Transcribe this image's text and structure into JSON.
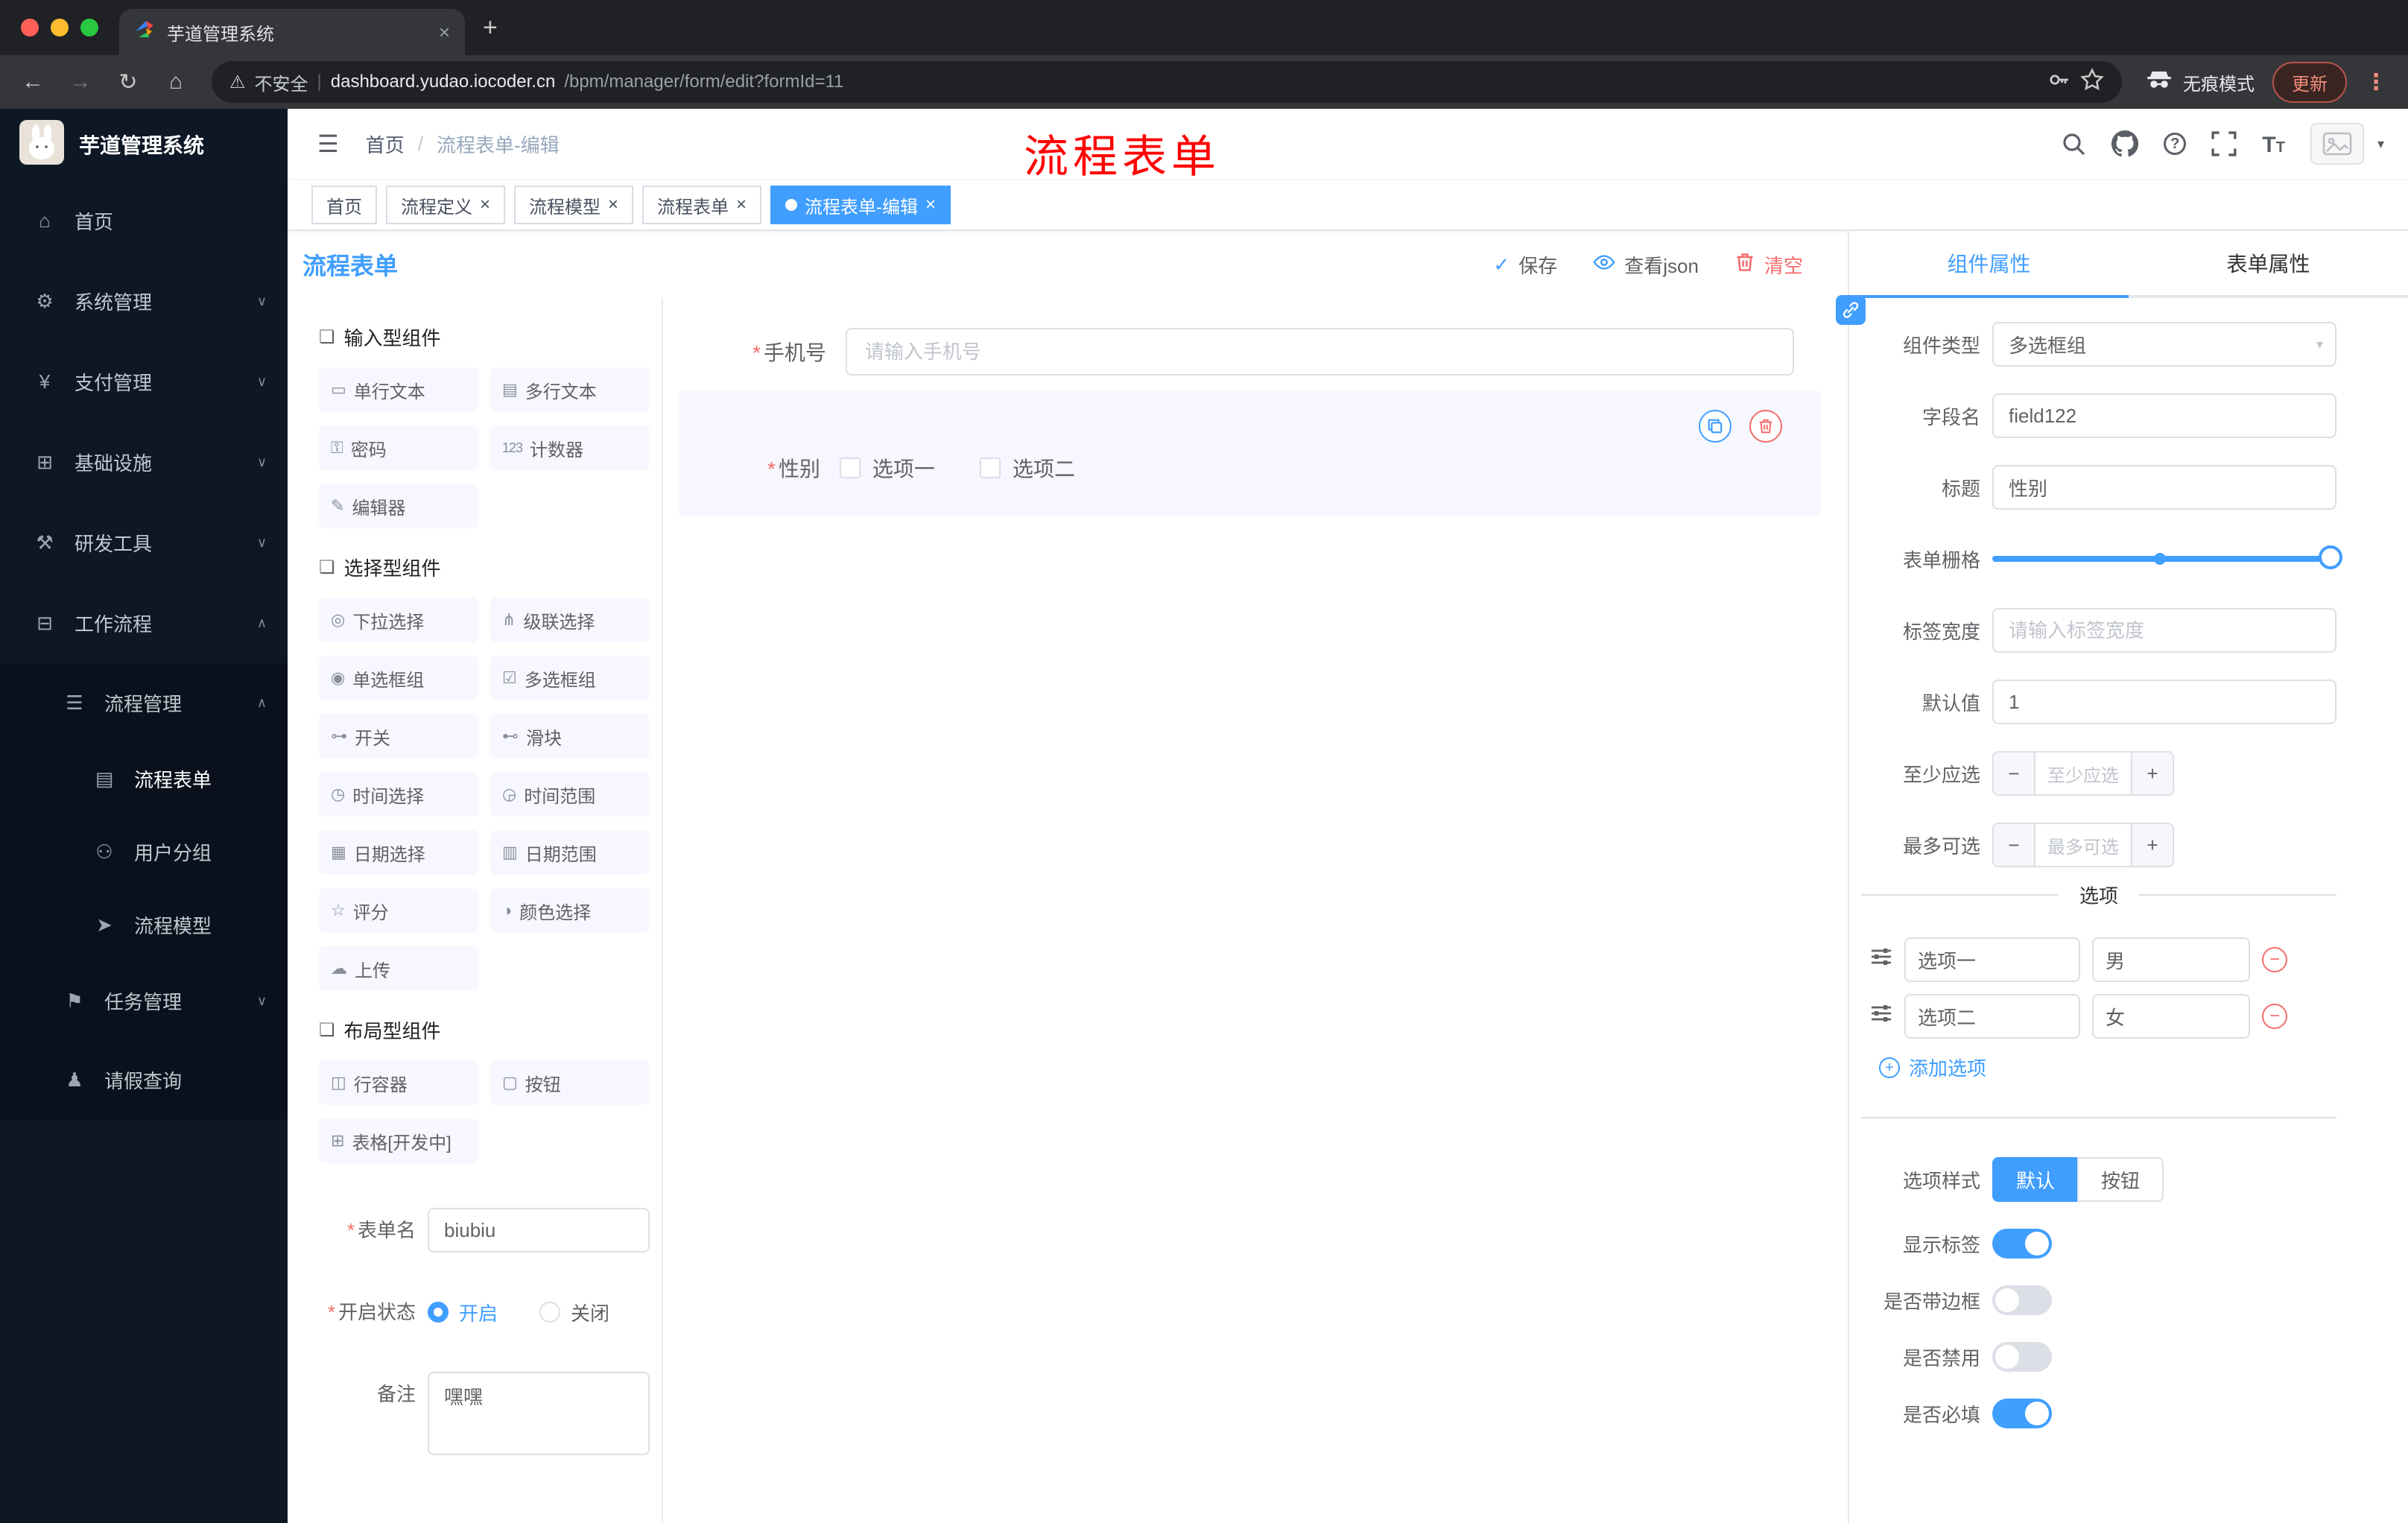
{
  "ui": {
    "close": "×",
    "plus": "+",
    "minus": "−",
    "dots": "⋮",
    "breadcrumb_sep": "/",
    "required": "*",
    "caret_down": "∨",
    "caret_up": "∧",
    "select_caret": "▾",
    "hamburger": "☰",
    "check": "✓",
    "section_icon": "❏",
    "question": "?",
    "size_big": "T",
    "size_small": "T",
    "back": "←",
    "forward": "→",
    "reload": "↻",
    "home": "⌂",
    "warning": "⚠"
  },
  "browser": {
    "tab_title": "芋道管理系统",
    "security_label": "不安全",
    "url_domain": "dashboard.yudao.iocoder.cn",
    "url_path": "/bpm/manager/form/edit?formId=11",
    "incognito_label": "无痕模式",
    "update_label": "更新"
  },
  "sidebar": {
    "logo_title": "芋道管理系统",
    "menu": [
      {
        "label": "首页",
        "icon": "⌂"
      },
      {
        "label": "系统管理",
        "icon": "⚙"
      },
      {
        "label": "支付管理",
        "icon": "¥"
      },
      {
        "label": "基础设施",
        "icon": "⊞"
      },
      {
        "label": "研发工具",
        "icon": "⚒"
      },
      {
        "label": "工作流程",
        "icon": "⊟"
      }
    ],
    "process_mgmt": {
      "label": "流程管理",
      "icon": "☰"
    },
    "children": [
      {
        "label": "流程表单",
        "icon": "▤"
      },
      {
        "label": "用户分组",
        "icon": "⚇"
      },
      {
        "label": "流程模型",
        "icon": "➤"
      }
    ],
    "siblings": [
      {
        "label": "任务管理",
        "icon": "⚑"
      },
      {
        "label": "请假查询",
        "icon": "♟"
      }
    ]
  },
  "header": {
    "breadcrumb_home": "首页",
    "breadcrumb_current": "流程表单-编辑",
    "annotation": "流程表单"
  },
  "tags": [
    {
      "label": "首页"
    },
    {
      "label": "流程定义"
    },
    {
      "label": "流程模型"
    },
    {
      "label": "流程表单"
    },
    {
      "label": "流程表单-编辑"
    }
  ],
  "designer": {
    "title": "流程表单",
    "save": "保存",
    "view_json": "查看json",
    "clear": "清空"
  },
  "palette": {
    "sections": [
      {
        "title": "输入型组件",
        "items": [
          {
            "label": "单行文本",
            "icon": "▭"
          },
          {
            "label": "多行文本",
            "icon": "▤"
          },
          {
            "label": "密码",
            "icon": "⚿"
          },
          {
            "label": "计数器",
            "icon": "123"
          },
          {
            "label": "编辑器",
            "icon": "✎"
          }
        ]
      },
      {
        "title": "选择型组件",
        "items": [
          {
            "label": "下拉选择",
            "icon": "◎"
          },
          {
            "label": "级联选择",
            "icon": "⋔"
          },
          {
            "label": "单选框组",
            "icon": "◉"
          },
          {
            "label": "多选框组",
            "icon": "☑"
          },
          {
            "label": "开关",
            "icon": "⊶"
          },
          {
            "label": "滑块",
            "icon": "⊷"
          },
          {
            "label": "时间选择",
            "icon": "◷"
          },
          {
            "label": "时间范围",
            "icon": "◶"
          },
          {
            "label": "日期选择",
            "icon": "▦"
          },
          {
            "label": "日期范围",
            "icon": "▥"
          },
          {
            "label": "评分",
            "icon": "☆"
          },
          {
            "label": "颜色选择",
            "icon": "◑"
          },
          {
            "label": "上传",
            "icon": "☁"
          }
        ]
      },
      {
        "title": "布局型组件",
        "items": [
          {
            "label": "行容器",
            "icon": "◫"
          },
          {
            "label": "按钮",
            "icon": "▢"
          },
          {
            "label": "表格[开发中]",
            "icon": "⊞"
          }
        ]
      }
    ],
    "form": {
      "name_label": "表单名",
      "name_value": "biubiu",
      "status_label": "开启状态",
      "status_on": "开启",
      "status_off": "关闭",
      "remark_label": "备注",
      "remark_value": "嘿嘿"
    }
  },
  "canvas": {
    "phone_label": "手机号",
    "phone_placeholder": "请输入手机号",
    "gender_label": "性别",
    "gender_option1": "选项一",
    "gender_option2": "选项二"
  },
  "props": {
    "tab_component": "组件属性",
    "tab_form": "表单属性",
    "rows": {
      "component_type_label": "组件类型",
      "component_type_value": "多选框组",
      "field_label": "字段名",
      "field_value": "field122",
      "title_label": "标题",
      "title_value": "性别",
      "grid_label": "表单栅格",
      "label_width_label": "标签宽度",
      "label_width_placeholder": "请输入标签宽度",
      "default_label": "默认值",
      "default_value": "1",
      "min_label": "至少应选",
      "min_placeholder": "至少应选",
      "max_label": "最多可选",
      "max_placeholder": "最多可选"
    },
    "options_title": "选项",
    "options": [
      {
        "label": "选项一",
        "value": "男"
      },
      {
        "label": "选项二",
        "value": "女"
      }
    ],
    "add_option": "添加选项",
    "style_label": "选项样式",
    "style_default": "默认",
    "style_button": "按钮",
    "show_label": "显示标签",
    "border_label": "是否带边框",
    "disabled_label": "是否禁用",
    "required_label": "是否必填"
  },
  "colors": {
    "accent": "#409eff",
    "danger": "#f56c6c",
    "annotation": "#ff0000",
    "sidebar_bg": "#0e1726"
  }
}
